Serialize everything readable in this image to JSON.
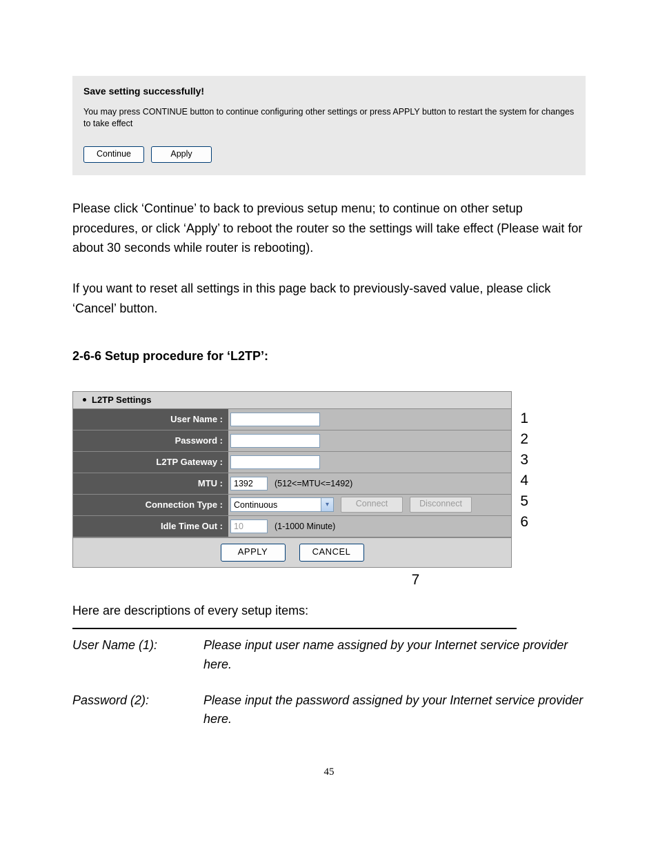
{
  "save_panel": {
    "title": "Save setting successfully!",
    "message": "You may press CONTINUE button to continue configuring other settings or press APPLY button to restart the system for changes to take effect",
    "continue_label": "Continue",
    "apply_label": "Apply"
  },
  "body": {
    "p1": "Please click ‘Continue’ to back to previous setup menu; to continue on other setup procedures, or click ‘Apply’ to reboot the router so the settings will take effect (Please wait for about 30 seconds while router is rebooting).",
    "p2": "If you want to reset all settings in this page back to previously-saved value, please click ‘Cancel’ button."
  },
  "section_heading": "2-6-6 Setup procedure for ‘L2TP’:",
  "settings": {
    "header": "L2TP Settings",
    "rows": {
      "user_name": {
        "label": "User Name :",
        "value": ""
      },
      "password": {
        "label": "Password :",
        "value": ""
      },
      "gateway": {
        "label": "L2TP Gateway :",
        "value": ""
      },
      "mtu": {
        "label": "MTU :",
        "value": "1392",
        "hint": "(512<=MTU<=1492)"
      },
      "conn_type": {
        "label": "Connection Type :",
        "value": "Continuous",
        "connect_label": "Connect",
        "disconnect_label": "Disconnect"
      },
      "idle_timeout": {
        "label": "Idle Time Out :",
        "value": "10",
        "hint": "(1-1000 Minute)"
      }
    },
    "apply_label": "APPLY",
    "cancel_label": "CANCEL",
    "annotations": [
      "1",
      "2",
      "3",
      "4",
      "5",
      "6",
      "7"
    ]
  },
  "descriptions": {
    "intro": "Here are descriptions of every setup items:",
    "items": [
      {
        "term": "User Name (1):",
        "def": "Please input user name assigned by your Internet service provider here."
      },
      {
        "term": "Password (2):",
        "def": "Please input the password assigned by your Internet service provider here."
      }
    ]
  },
  "page_number": "45"
}
